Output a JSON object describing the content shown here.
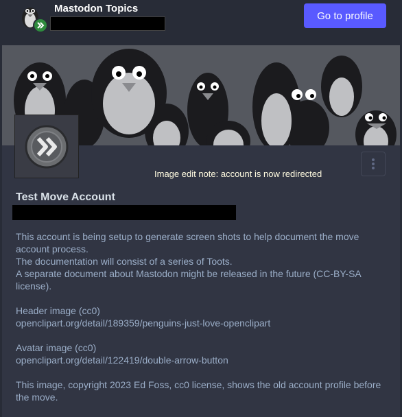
{
  "topbar": {
    "title": "Mastodon Topics",
    "go_to_profile_label": "Go to profile"
  },
  "profile": {
    "edit_note": "Image edit note: account is now redirected",
    "display_name": "Test Move Account",
    "menu_icon": "more-vertical-icon"
  },
  "bio": {
    "p1_l1": "This account is being setup to generate screen shots to help document the move",
    "p1_l2": "account process.",
    "p1_l3": "The documentation will consist of a series of Toots.",
    "p1_l4": "A separate document about Mastodon might be released in the future (CC-BY-SA",
    "p1_l5": "license).",
    "p2_l1": "Header image (cc0)",
    "p2_l2": "openclipart.org/detail/189359/penguins-just-love-openclipart",
    "p3_l1": "Avatar image (cc0)",
    "p3_l2": "openclipart.org/detail/122419/double-arrow-button",
    "p4_l1": "This image, copyright 2023 Ed Foss, cc0 license, shows the old account profile before",
    "p4_l2": "the move."
  },
  "colors": {
    "background": "#282c37",
    "accent": "#595aff",
    "note_text": "#fffbe0"
  }
}
